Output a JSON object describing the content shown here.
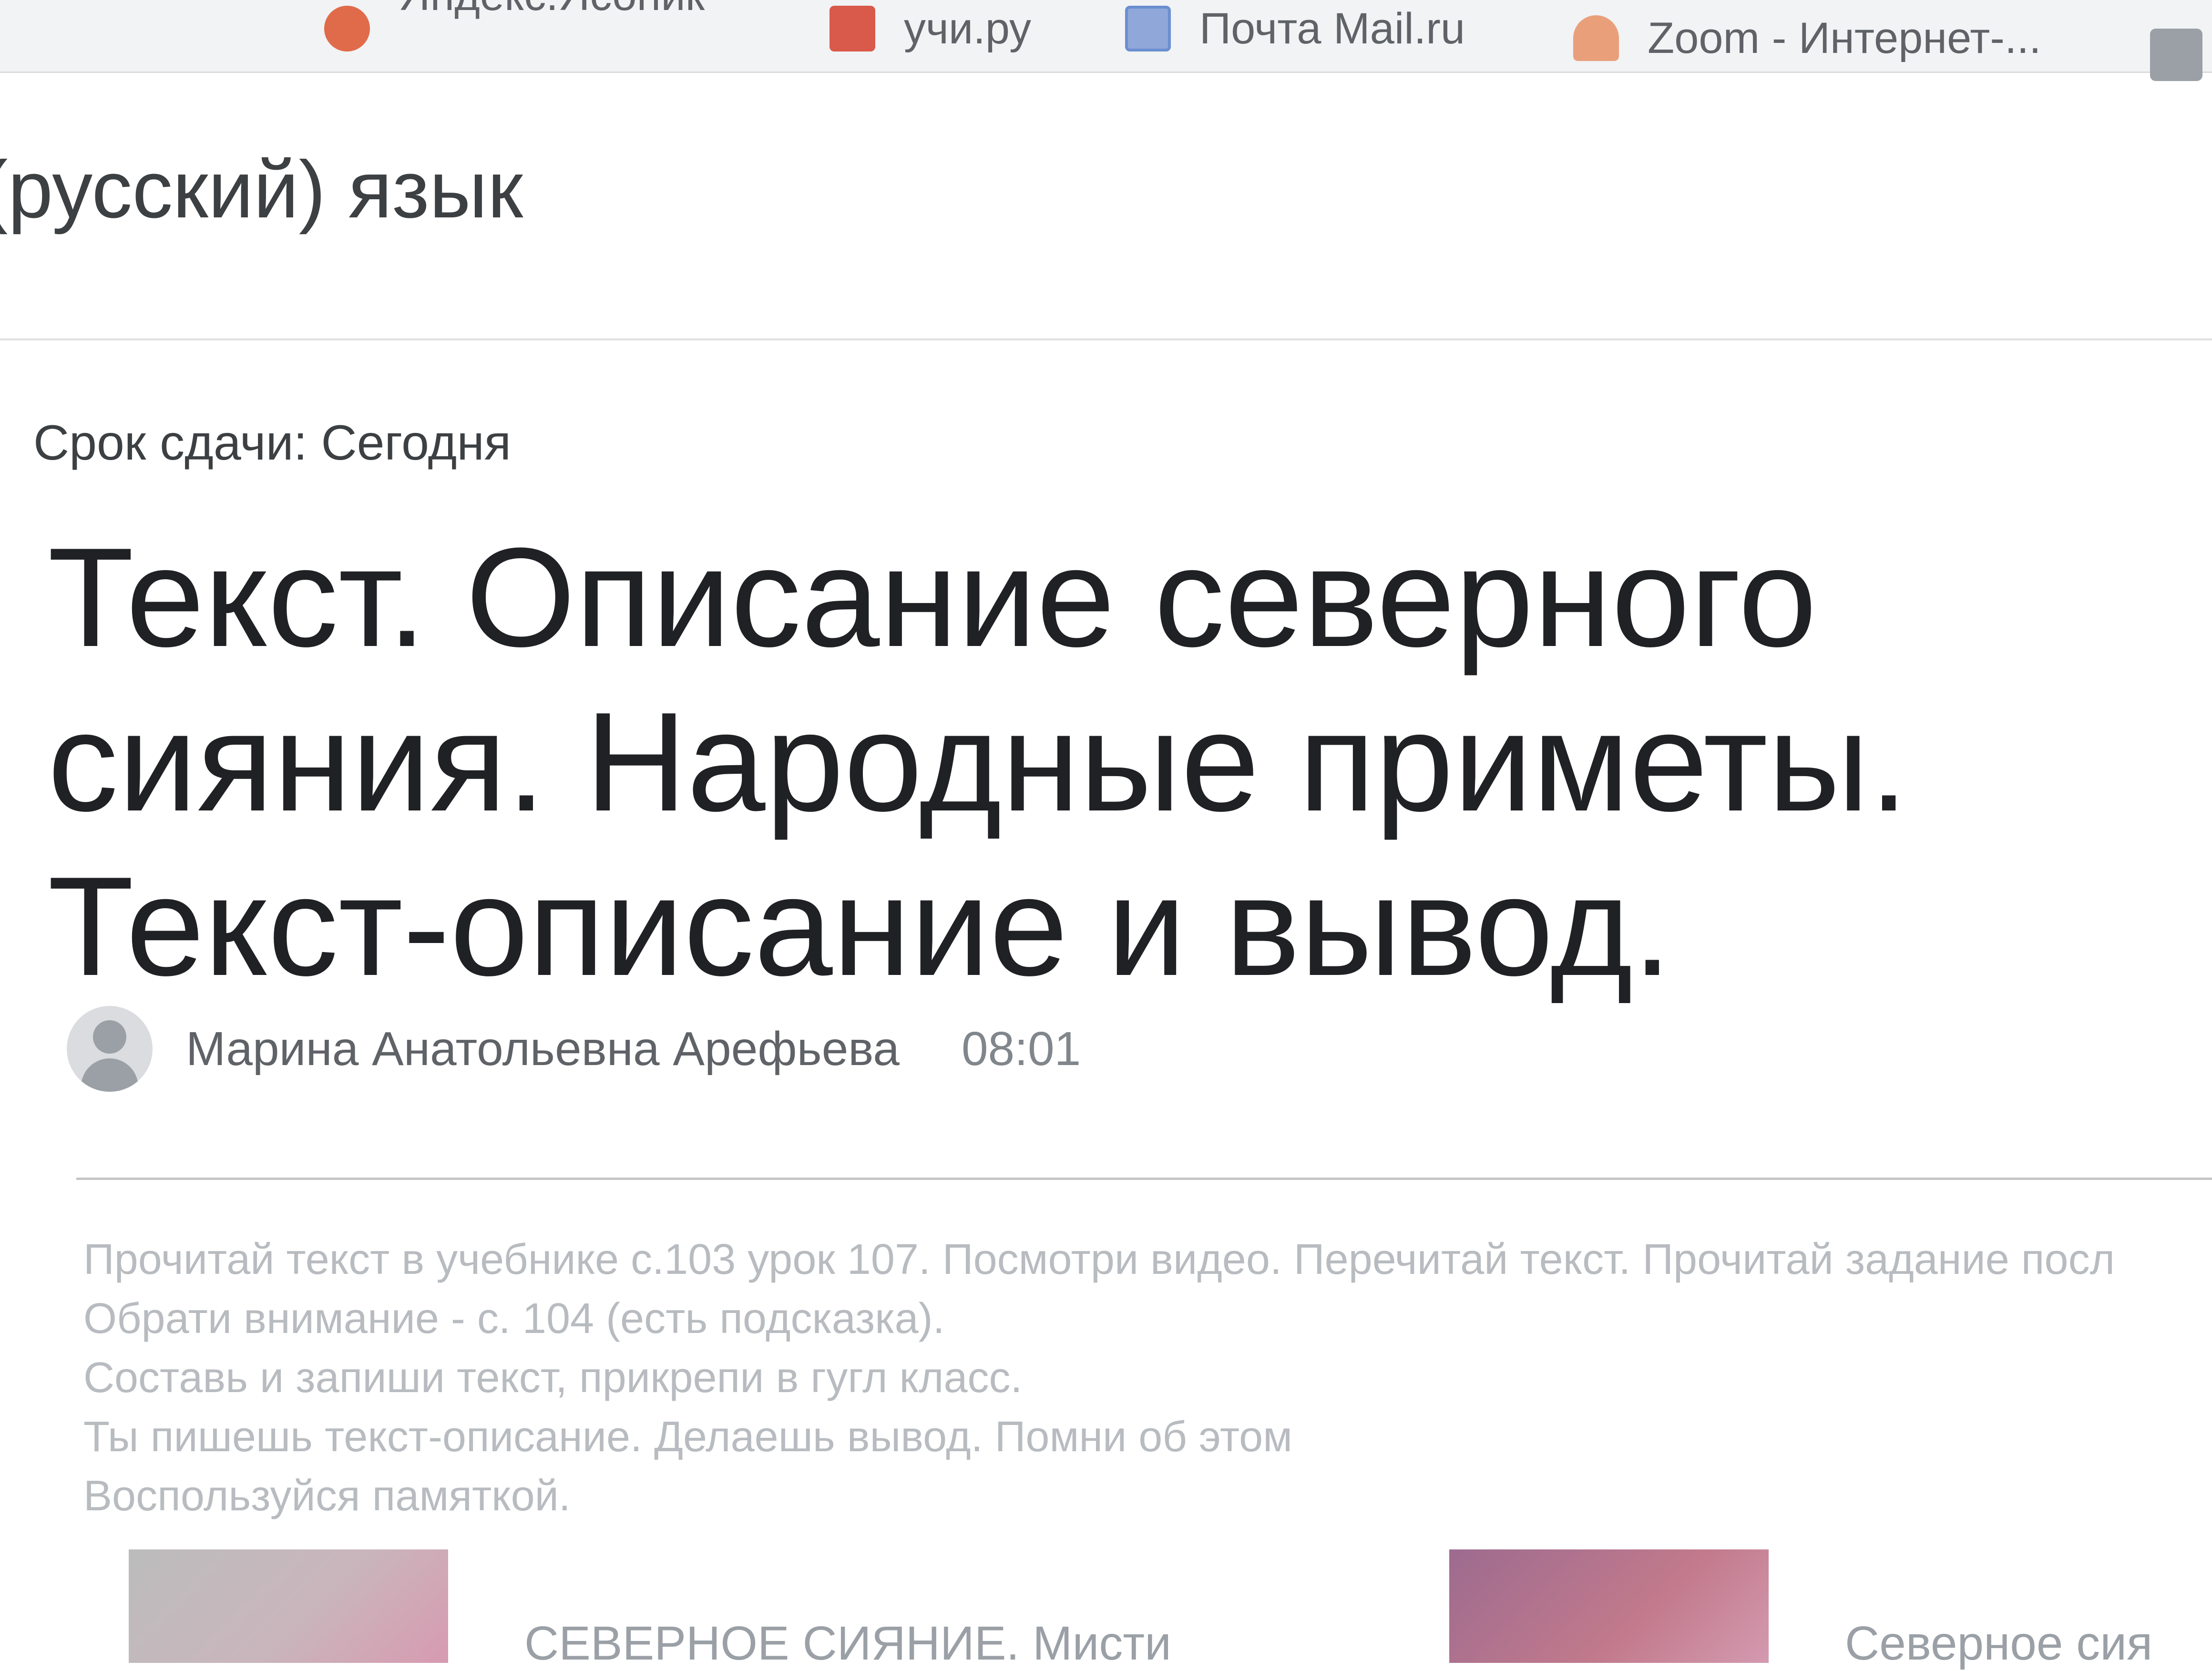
{
  "bookmarks": [
    {
      "label": "Яндекс.Ясоник",
      "icon": "yandex-icon"
    },
    {
      "label": "учи.ру",
      "icon": "uchi-icon"
    },
    {
      "label": "Почта Mail.ru",
      "icon": "mail-icon"
    },
    {
      "label": "Zoom - Интернет-...",
      "icon": "zoom-icon"
    }
  ],
  "class": {
    "title": "(русский) язык"
  },
  "assignment": {
    "due": "Срок сдачи: Сегодня",
    "title": "Текст. Описание северного сияния. Народные приметы. Текст-описание и вывод.",
    "author": "Марина Анатольевна Арефьева",
    "time": "08:01",
    "instructions": [
      "Прочитай текст в учебнике с.103 урок 107. Посмотри видео. Перечитай текст. Прочитай задание посл",
      "Обрати внимание - с. 104 (есть подсказка).",
      "Составь и запиши текст, прикрепи в гугл класс.",
      "Ты пишешь текст-описание. Делаешь вывод. Помни об этом",
      "Воспользуйся памяткой."
    ],
    "attachments": [
      {
        "title": "СЕВЕРНОЕ СИЯНИЕ. Мисти"
      },
      {
        "title": "Северное сия"
      }
    ]
  }
}
